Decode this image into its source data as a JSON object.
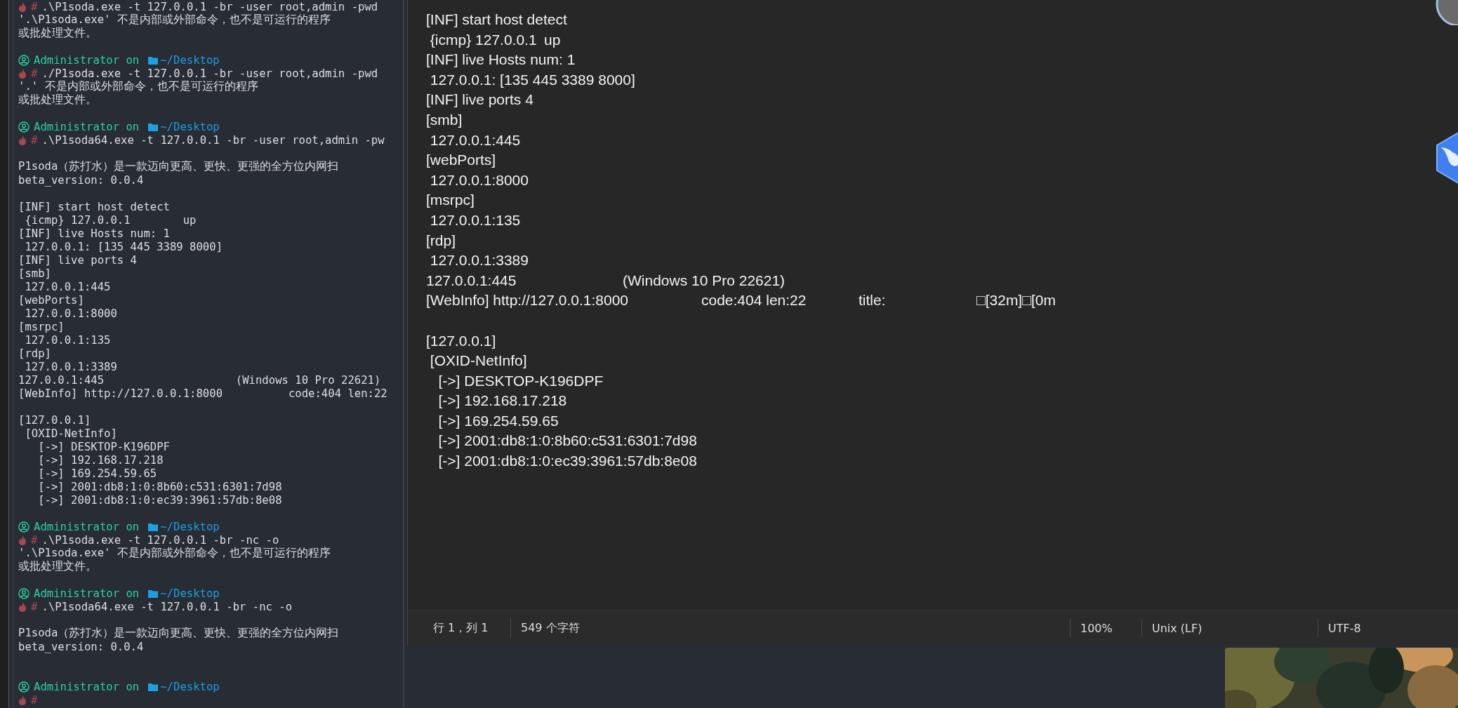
{
  "terminal": {
    "lines": [
      {
        "kind": "command",
        "symbol": "#",
        "text": ".\\P1soda.exe -t 127.0.0.1 -br -user root,admin -pwd"
      },
      {
        "kind": "output",
        "text": "'.\\P1soda.exe' 不是内部或外部命令，也不是可运行的程序"
      },
      {
        "kind": "output",
        "text": "或批处理文件。"
      },
      {
        "kind": "blank"
      },
      {
        "kind": "prompt",
        "user": "Administrator",
        "word": "on",
        "path": "~/Desktop"
      },
      {
        "kind": "command",
        "symbol": "#",
        "text": "./P1soda.exe -t 127.0.0.1 -br -user root,admin -pwd"
      },
      {
        "kind": "output",
        "text": "'.' 不是内部或外部命令，也不是可运行的程序"
      },
      {
        "kind": "output",
        "text": "或批处理文件。"
      },
      {
        "kind": "blank"
      },
      {
        "kind": "prompt",
        "user": "Administrator",
        "word": "on",
        "path": "~/Desktop"
      },
      {
        "kind": "command",
        "symbol": "#",
        "text": ".\\P1soda64.exe -t 127.0.0.1 -br -user root,admin -pw"
      },
      {
        "kind": "blank"
      },
      {
        "kind": "output",
        "text": "P1soda（苏打水）是一款迈向更高、更快、更强的全方位内网扫"
      },
      {
        "kind": "output",
        "text": "beta_version: 0.0.4"
      },
      {
        "kind": "blank"
      },
      {
        "kind": "output",
        "text": "[INF] start host detect"
      },
      {
        "kind": "output",
        "text": " {icmp} 127.0.0.1        up"
      },
      {
        "kind": "output",
        "text": "[INF] live Hosts num: 1"
      },
      {
        "kind": "output",
        "text": " 127.0.0.1: [135 445 3389 8000]"
      },
      {
        "kind": "output",
        "text": "[INF] live ports 4"
      },
      {
        "kind": "output",
        "text": "[smb]"
      },
      {
        "kind": "output",
        "text": " 127.0.0.1:445"
      },
      {
        "kind": "output",
        "text": "[webPorts]"
      },
      {
        "kind": "output",
        "text": " 127.0.0.1:8000"
      },
      {
        "kind": "output",
        "text": "[msrpc]"
      },
      {
        "kind": "output",
        "text": " 127.0.0.1:135"
      },
      {
        "kind": "output",
        "text": "[rdp]"
      },
      {
        "kind": "output",
        "text": " 127.0.0.1:3389"
      },
      {
        "kind": "output",
        "text": "127.0.0.1:445                    (Windows 10 Pro 22621)"
      },
      {
        "kind": "output",
        "text": "[WebInfo] http://127.0.0.1:8000          code:404 len:22"
      },
      {
        "kind": "blank"
      },
      {
        "kind": "output",
        "text": "[127.0.0.1]"
      },
      {
        "kind": "output",
        "text": " [OXID-NetInfo]"
      },
      {
        "kind": "output",
        "text": "   [->] DESKTOP-K196DPF"
      },
      {
        "kind": "output",
        "text": "   [->] 192.168.17.218"
      },
      {
        "kind": "output",
        "text": "   [->] 169.254.59.65"
      },
      {
        "kind": "output",
        "text": "   [->] 2001:db8:1:0:8b60:c531:6301:7d98"
      },
      {
        "kind": "output",
        "text": "   [->] 2001:db8:1:0:ec39:3961:57db:8e08"
      },
      {
        "kind": "blank"
      },
      {
        "kind": "prompt",
        "user": "Administrator",
        "word": "on",
        "path": "~/Desktop"
      },
      {
        "kind": "command",
        "symbol": "#",
        "text": ".\\P1soda.exe -t 127.0.0.1 -br -nc -o"
      },
      {
        "kind": "output",
        "text": "'.\\P1soda.exe' 不是内部或外部命令，也不是可运行的程序"
      },
      {
        "kind": "output",
        "text": "或批处理文件。"
      },
      {
        "kind": "blank"
      },
      {
        "kind": "prompt",
        "user": "Administrator",
        "word": "on",
        "path": "~/Desktop"
      },
      {
        "kind": "command",
        "symbol": "#",
        "text": ".\\P1soda64.exe -t 127.0.0.1 -br -nc -o"
      },
      {
        "kind": "blank"
      },
      {
        "kind": "output",
        "text": "P1soda（苏打水）是一款迈向更高、更快、更强的全方位内网扫"
      },
      {
        "kind": "output",
        "text": "beta_version: 0.0.4"
      },
      {
        "kind": "blank"
      },
      {
        "kind": "blank"
      },
      {
        "kind": "prompt",
        "user": "Administrator",
        "word": "on",
        "path": "~/Desktop"
      },
      {
        "kind": "command",
        "symbol": "#"
      }
    ]
  },
  "editor": {
    "lines": [
      {
        "kind": "text",
        "text": "[INF] start host detect"
      },
      {
        "kind": "text",
        "text": " {icmp} 127.0.0.1\tup"
      },
      {
        "kind": "text",
        "text": "[INF] live Hosts num: 1"
      },
      {
        "kind": "text",
        "text": " 127.0.0.1: [135 445 3389 8000]"
      },
      {
        "kind": "text",
        "text": "[INF] live ports 4"
      },
      {
        "kind": "text",
        "text": "[smb]"
      },
      {
        "kind": "text",
        "text": " 127.0.0.1:445"
      },
      {
        "kind": "text",
        "text": "[webPorts]"
      },
      {
        "kind": "text",
        "text": " 127.0.0.1:8000"
      },
      {
        "kind": "text",
        "text": "[msrpc]"
      },
      {
        "kind": "text",
        "text": " 127.0.0.1:135"
      },
      {
        "kind": "text",
        "text": "[rdp]"
      },
      {
        "kind": "text",
        "text": " 127.0.0.1:3389"
      },
      {
        "kind": "text",
        "text": "127.0.0.1:445\t\t\t(Windows 10 Pro 22621)"
      },
      {
        "kind": "text",
        "text": "[WebInfo] http://127.0.0.1:8000\t\tcode:404 len:22\t\ttitle:\t\t\t□[32m]□[0m"
      },
      {
        "kind": "blank"
      },
      {
        "kind": "text",
        "text": "[127.0.0.1]"
      },
      {
        "kind": "text",
        "text": " [OXID-NetInfo]"
      },
      {
        "kind": "text",
        "text": "   [->] DESKTOP-K196DPF"
      },
      {
        "kind": "text",
        "text": "   [->] 192.168.17.218"
      },
      {
        "kind": "text",
        "text": "   [->] 169.254.59.65"
      },
      {
        "kind": "text",
        "text": "   [->] 2001:db8:1:0:8b60:c531:6301:7d98"
      },
      {
        "kind": "text",
        "text": "   [->] 2001:db8:1:0:ec39:3961:57db:8e08"
      }
    ]
  },
  "status_bar": [
    "行 1，列 1",
    "549 个字符",
    "100%",
    "Unix (LF)",
    "UTF-8"
  ]
}
